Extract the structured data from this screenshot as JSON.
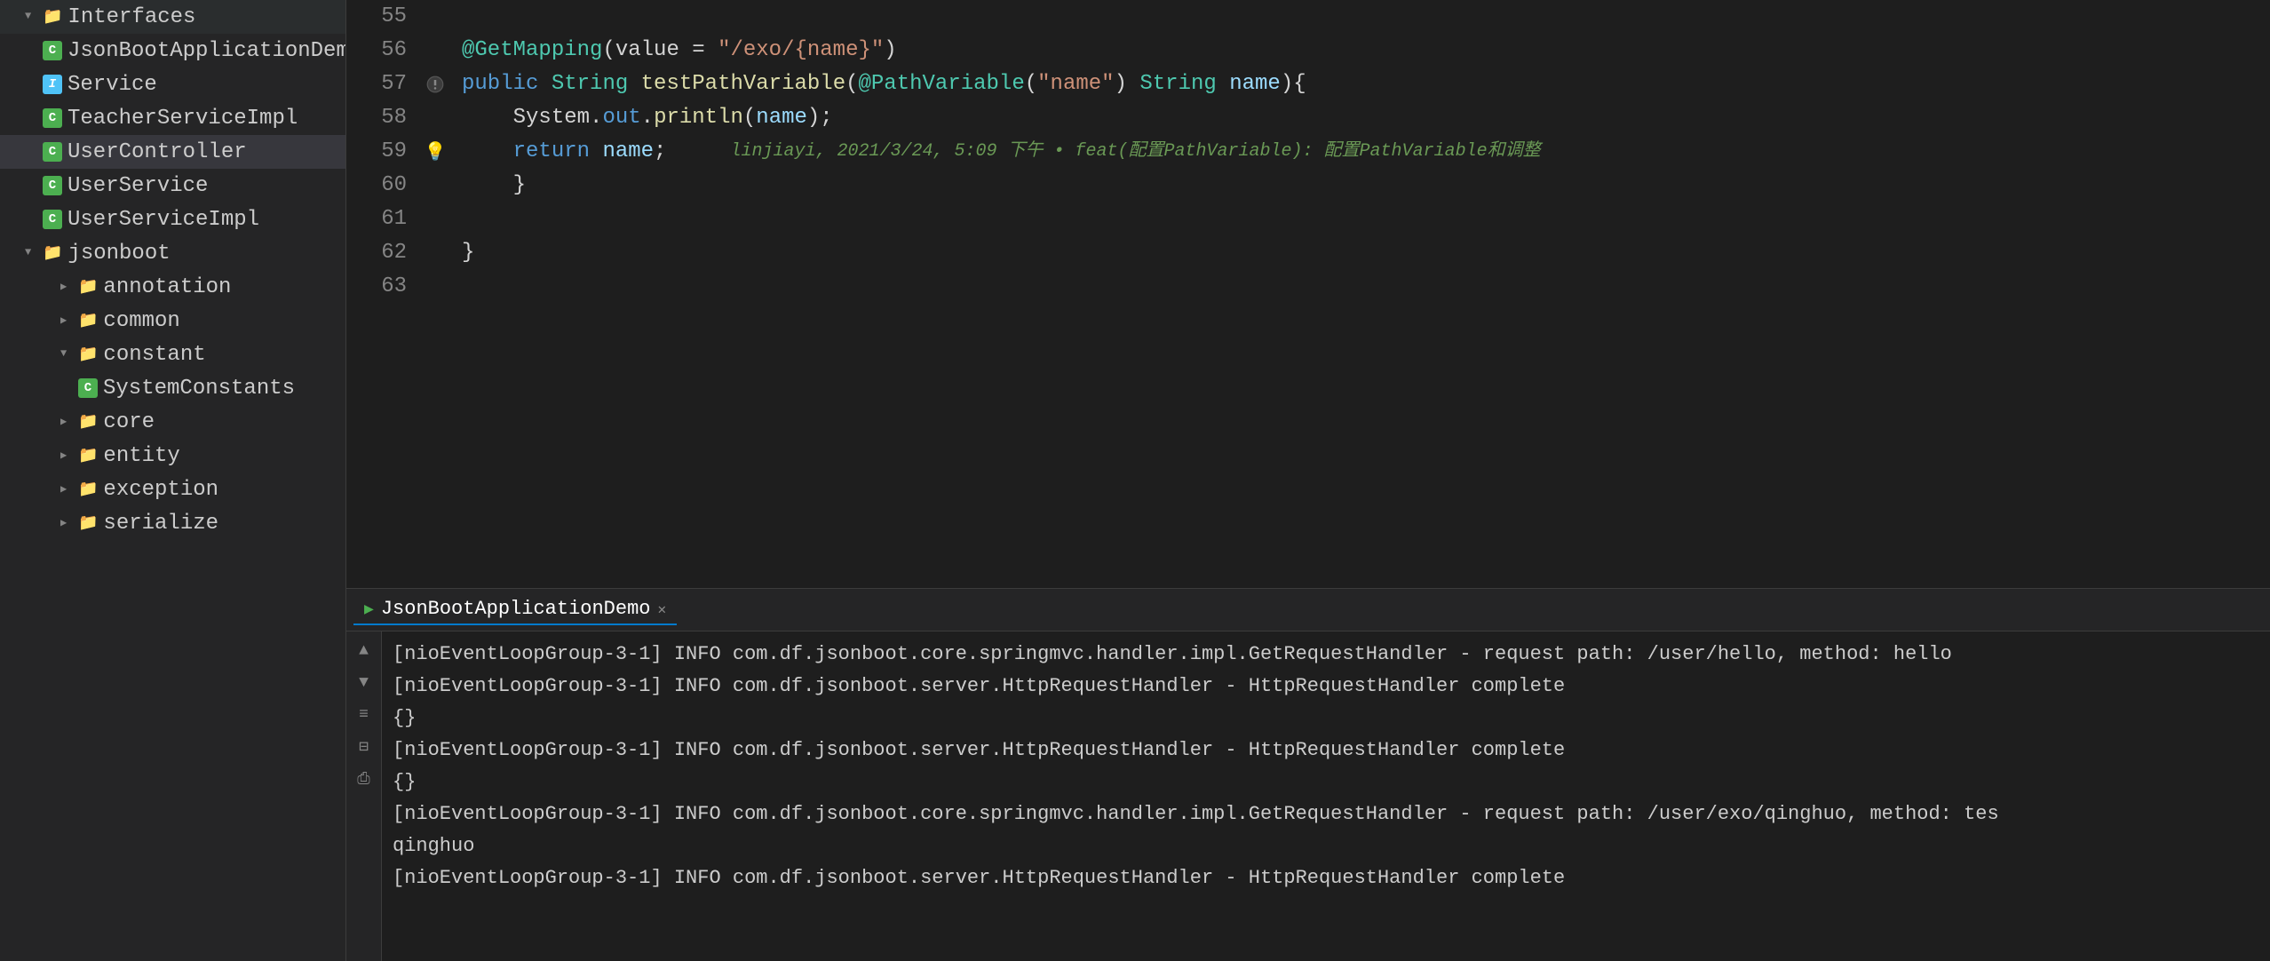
{
  "sidebar": {
    "items": [
      {
        "id": "interfaces",
        "label": "Interfaces",
        "type": "folder",
        "indent": 1,
        "expanded": true,
        "collapsed": false
      },
      {
        "id": "jsonBootApplicationDemo",
        "label": "JsonBootApplicationDemo",
        "type": "class",
        "indent": 2
      },
      {
        "id": "service",
        "label": "Service",
        "type": "interface",
        "indent": 2
      },
      {
        "id": "teacherServiceImpl",
        "label": "TeacherServiceImpl",
        "type": "class",
        "indent": 2
      },
      {
        "id": "userController",
        "label": "UserController",
        "type": "class",
        "indent": 2,
        "selected": true
      },
      {
        "id": "userService",
        "label": "UserService",
        "type": "class",
        "indent": 2
      },
      {
        "id": "userServiceImpl",
        "label": "UserServiceImpl",
        "type": "class",
        "indent": 2
      },
      {
        "id": "jsonboot",
        "label": "jsonboot",
        "type": "folder",
        "indent": 1,
        "expanded": true
      },
      {
        "id": "annotation",
        "label": "annotation",
        "type": "folder",
        "indent": 2,
        "collapsed": true
      },
      {
        "id": "common",
        "label": "common",
        "type": "folder",
        "indent": 2,
        "collapsed": true
      },
      {
        "id": "constant",
        "label": "constant",
        "type": "folder",
        "indent": 2,
        "expanded": true
      },
      {
        "id": "systemConstants",
        "label": "SystemConstants",
        "type": "class",
        "indent": 3
      },
      {
        "id": "core",
        "label": "core",
        "type": "folder",
        "indent": 2,
        "collapsed": true
      },
      {
        "id": "entity",
        "label": "entity",
        "type": "folder",
        "indent": 2,
        "collapsed": true
      },
      {
        "id": "exception",
        "label": "exception",
        "type": "folder",
        "indent": 2,
        "collapsed": true
      },
      {
        "id": "serialize",
        "label": "serialize",
        "type": "folder",
        "indent": 2,
        "collapsed": true
      }
    ]
  },
  "editor": {
    "lines": [
      {
        "num": 55,
        "content": "",
        "gutter": ""
      },
      {
        "num": 56,
        "content": "    @GetMapping(value = \"/exo/{name}\")",
        "gutter": ""
      },
      {
        "num": 57,
        "content": "    public String testPathVariable(@PathVariable(\"name\") String name){",
        "gutter": ""
      },
      {
        "num": 58,
        "content": "        System.out.println(name);",
        "gutter": ""
      },
      {
        "num": 59,
        "content": "        return name;",
        "gutter": "bulb",
        "inline_hint": "    linjiayi, 2021/3/24, 5:09 下午 • feat(配置PathVariable): 配置PathVariable和调整"
      },
      {
        "num": 60,
        "content": "    }",
        "gutter": ""
      },
      {
        "num": 61,
        "content": "",
        "gutter": ""
      },
      {
        "num": 62,
        "content": "}",
        "gutter": ""
      },
      {
        "num": 63,
        "content": "",
        "gutter": ""
      }
    ]
  },
  "bottom_panel": {
    "tabs": [
      {
        "id": "run",
        "label": "JsonBootApplicationDemo",
        "active": true,
        "closable": true
      }
    ],
    "console_lines": [
      "[nioEventLoopGroup-3-1] INFO com.df.jsonboot.core.springmvc.handler.impl.GetRequestHandler - request path: /user/hello, method: hello",
      "[nioEventLoopGroup-3-1] INFO com.df.jsonboot.server.HttpRequestHandler - HttpRequestHandler complete",
      "{}",
      "[nioEventLoopGroup-3-1] INFO com.df.jsonboot.server.HttpRequestHandler - HttpRequestHandler complete",
      "{}",
      "[nioEventLoopGroup-3-1] INFO com.df.jsonboot.core.springmvc.handler.impl.GetRequestHandler - request path: /user/exo/qinghuo, method: tes",
      "qinghuo",
      "[nioEventLoopGroup-3-1] INFO com.df.jsonboot.server.HttpRequestHandler - HttpRequestHandler complete"
    ],
    "side_buttons": [
      {
        "icon": "▲",
        "label": "up"
      },
      {
        "icon": "▼",
        "label": "down"
      },
      {
        "icon": "≡",
        "label": "wrap"
      },
      {
        "icon": "⊟",
        "label": "filter"
      },
      {
        "icon": "⎙",
        "label": "print"
      }
    ]
  }
}
